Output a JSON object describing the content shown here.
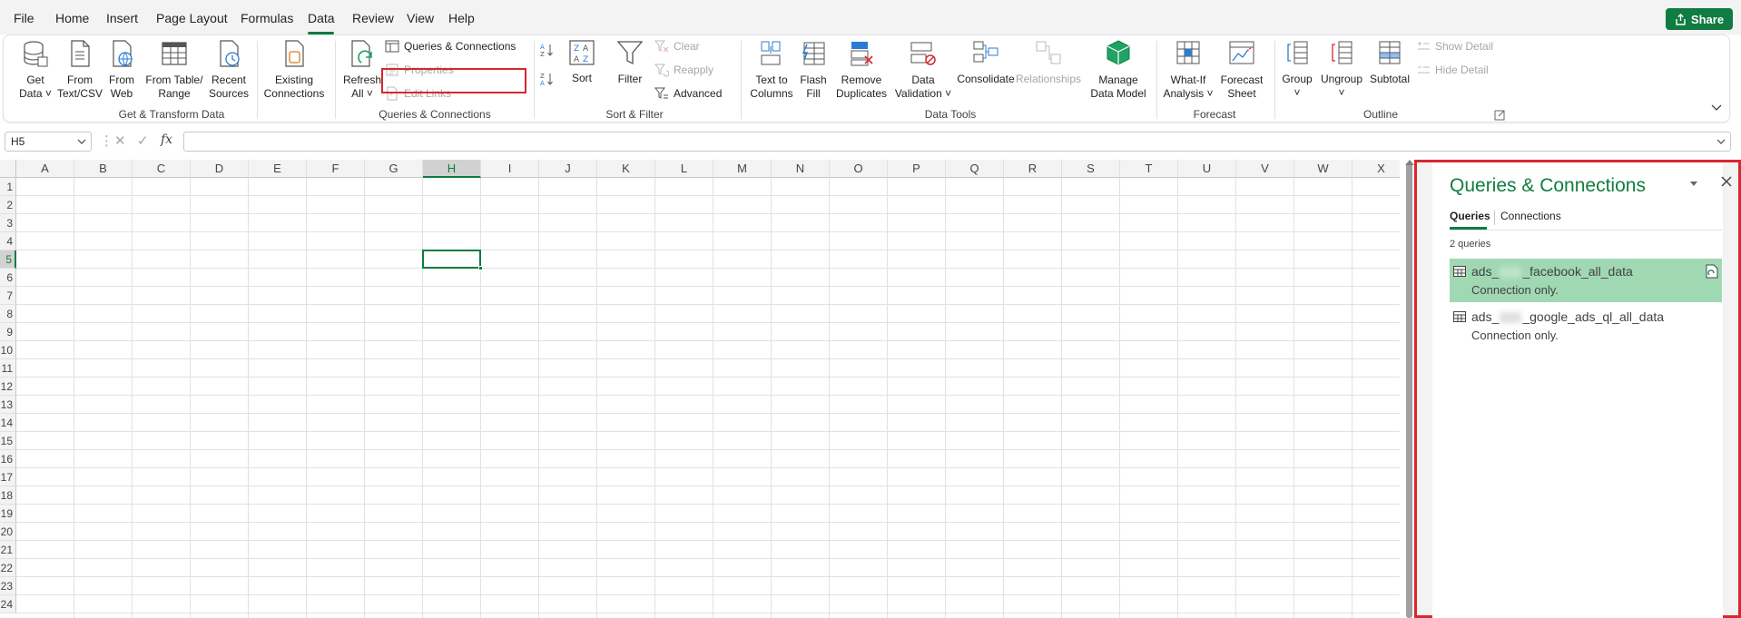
{
  "menu": {
    "items": [
      {
        "label": "File"
      },
      {
        "label": "Home"
      },
      {
        "label": "Insert"
      },
      {
        "label": "Page Layout"
      },
      {
        "label": "Formulas"
      },
      {
        "label": "Data"
      },
      {
        "label": "Review"
      },
      {
        "label": "View"
      },
      {
        "label": "Help"
      }
    ],
    "active": "Data",
    "share_label": "Share"
  },
  "ribbon": {
    "get_transform": {
      "get_data_1": "Get",
      "get_data_2": "Data ˅",
      "from_text_1": "From",
      "from_text_2": "Text/CSV",
      "from_web_1": "From",
      "from_web_2": "Web",
      "from_table_1": "From Table/",
      "from_table_2": "Range",
      "recent_1": "Recent",
      "recent_2": "Sources",
      "existing_1": "Existing",
      "existing_2": "Connections",
      "group_label": "Get & Transform Data"
    },
    "queries": {
      "refresh_1": "Refresh",
      "refresh_2": "All ˅",
      "queries_connections": "Queries & Connections",
      "properties": "Properties",
      "edit_links": "Edit Links",
      "group_label": "Queries & Connections"
    },
    "sort_filter": {
      "sort": "Sort",
      "filter": "Filter",
      "clear": "Clear",
      "reapply": "Reapply",
      "advanced": "Advanced",
      "group_label": "Sort & Filter"
    },
    "data_tools": {
      "text_columns_1": "Text to",
      "text_columns_2": "Columns",
      "flash_fill_1": "Flash",
      "flash_fill_2": "Fill",
      "remove_dup_1": "Remove",
      "remove_dup_2": "Duplicates",
      "validation_1": "Data",
      "validation_2": "Validation ˅",
      "consolidate": "Consolidate",
      "relationships": "Relationships",
      "manage_model_1": "Manage",
      "manage_model_2": "Data Model",
      "group_label": "Data Tools"
    },
    "forecast": {
      "whatif_1": "What-If",
      "whatif_2": "Analysis ˅",
      "sheet_1": "Forecast",
      "sheet_2": "Sheet",
      "group_label": "Forecast"
    },
    "outline": {
      "group": "Group",
      "ungroup": "Ungroup",
      "subtotal": "Subtotal",
      "show_detail": "Show Detail",
      "hide_detail": "Hide Detail",
      "group_label": "Outline"
    }
  },
  "formula_bar": {
    "name_box": "H5",
    "fx": "fx",
    "value": ""
  },
  "grid": {
    "columns": [
      "A",
      "B",
      "C",
      "D",
      "E",
      "F",
      "G",
      "H",
      "I",
      "J",
      "K",
      "L",
      "M",
      "N",
      "O",
      "P",
      "Q",
      "R",
      "S",
      "T",
      "U",
      "V",
      "W",
      "X"
    ],
    "rows": [
      "1",
      "2",
      "3",
      "4",
      "5",
      "6",
      "7",
      "8",
      "9",
      "10",
      "11",
      "12",
      "13",
      "14",
      "15",
      "16",
      "17",
      "18",
      "19",
      "20",
      "21",
      "22",
      "23",
      "24"
    ],
    "selected_column": "H",
    "selected_row": "5"
  },
  "pane": {
    "title": "Queries & Connections",
    "tabs": [
      "Queries",
      "Connections"
    ],
    "active_tab": "Queries",
    "count": "2 queries",
    "queries": [
      {
        "prefix": "ads_",
        "suffix": "_facebook_all_data",
        "status": "Connection only."
      },
      {
        "prefix": "ads_",
        "suffix": "_google_ads_ql_all_data",
        "status": "Connection only."
      }
    ]
  },
  "colors": {
    "accent": "#107c41",
    "highlight_border": "#d9272e",
    "selected_item": "#a0d8b3"
  }
}
